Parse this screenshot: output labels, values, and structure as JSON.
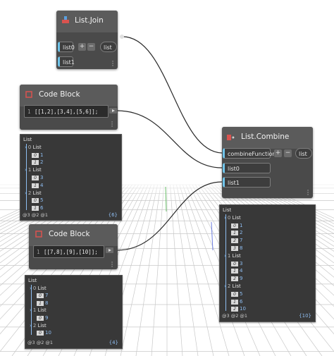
{
  "nodes": {
    "list_join": {
      "title": "List.Join",
      "inputs": [
        "list0",
        "list1"
      ],
      "output": "list",
      "plus": "+",
      "minus": "−"
    },
    "code_block_1": {
      "title": "Code Block",
      "line_number": "1",
      "code": "[[1,2],[3,4],[5,6]];"
    },
    "code_block_2": {
      "title": "Code Block",
      "line_number": "1",
      "code": "[[7,8],[9],[10]];"
    },
    "list_combine": {
      "title": "List.Combine",
      "inputs": [
        "combineFunction",
        "list0",
        "list1"
      ],
      "output": "list",
      "plus": "+",
      "minus": "−"
    }
  },
  "previews": {
    "preview_1": {
      "root": "List",
      "groups": [
        {
          "index": "0",
          "label": "List",
          "items": [
            {
              "i": "0",
              "v": "1"
            },
            {
              "i": "1",
              "v": "2"
            }
          ]
        },
        {
          "index": "1",
          "label": "List",
          "items": [
            {
              "i": "0",
              "v": "3"
            },
            {
              "i": "1",
              "v": "4"
            }
          ]
        },
        {
          "index": "2",
          "label": "List",
          "items": [
            {
              "i": "0",
              "v": "5"
            },
            {
              "i": "1",
              "v": "6"
            }
          ]
        }
      ],
      "levels": "@3 @2 @1",
      "count": "{6}"
    },
    "preview_2": {
      "root": "List",
      "groups": [
        {
          "index": "0",
          "label": "List",
          "items": [
            {
              "i": "0",
              "v": "7"
            },
            {
              "i": "1",
              "v": "8"
            }
          ]
        },
        {
          "index": "1",
          "label": "List",
          "items": [
            {
              "i": "0",
              "v": "9"
            }
          ]
        },
        {
          "index": "2",
          "label": "List",
          "items": [
            {
              "i": "0",
              "v": "10"
            }
          ]
        }
      ],
      "levels": "@3 @2 @1",
      "count": "{4}"
    },
    "preview_3": {
      "root": "List",
      "groups": [
        {
          "index": "0",
          "label": "List",
          "items": [
            {
              "i": "0",
              "v": "1"
            },
            {
              "i": "1",
              "v": "2"
            },
            {
              "i": "2",
              "v": "7"
            },
            {
              "i": "3",
              "v": "8"
            }
          ]
        },
        {
          "index": "1",
          "label": "List",
          "items": [
            {
              "i": "0",
              "v": "3"
            },
            {
              "i": "1",
              "v": "4"
            },
            {
              "i": "2",
              "v": "9"
            }
          ]
        },
        {
          "index": "2",
          "label": "List",
          "items": [
            {
              "i": "0",
              "v": "5"
            },
            {
              "i": "1",
              "v": "6"
            },
            {
              "i": "2",
              "v": "10"
            }
          ]
        }
      ],
      "levels": "@3 @2 @1",
      "count": "{10}"
    }
  },
  "colors": {
    "node_body": "#4a4a4a",
    "node_header": "#5b5b5b",
    "input_accent": "#6ec3e9",
    "value_blue": "#8fbef2",
    "wire": "#2a2a2a",
    "grid": "#c9c9c9"
  }
}
